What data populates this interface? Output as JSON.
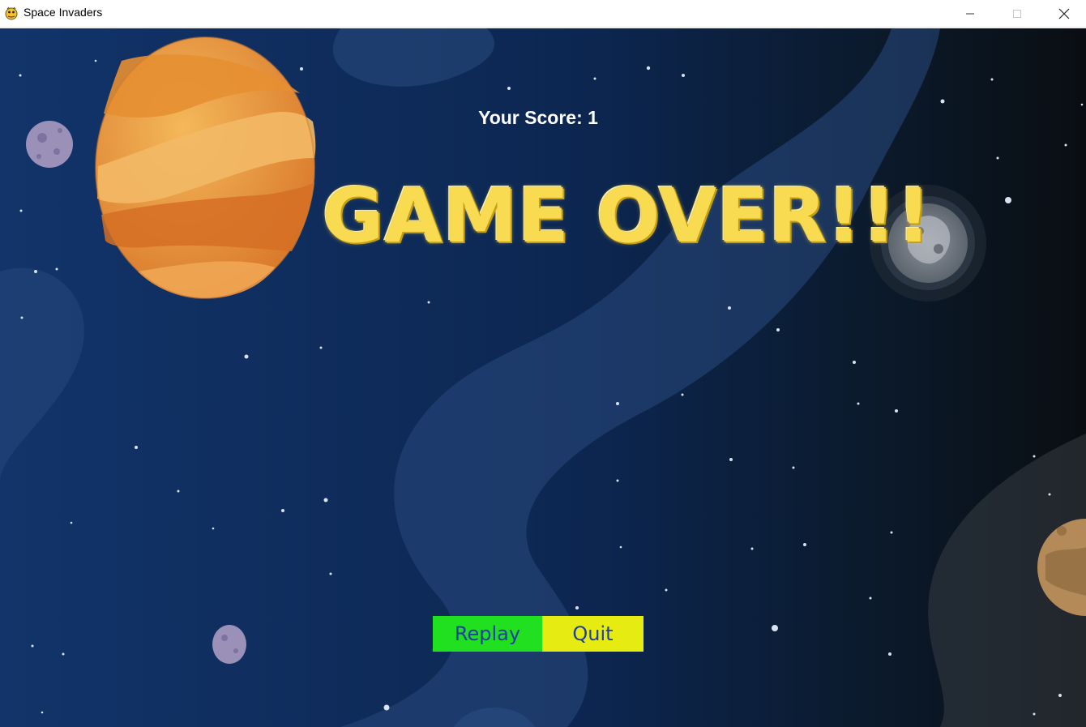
{
  "window": {
    "title": "Space Invaders",
    "icon": "pygame-snake-icon",
    "controls": {
      "minimize": "minimize-icon",
      "maximize": "maximize-icon",
      "close": "close-icon"
    }
  },
  "game": {
    "score_text": "Your Score: 1",
    "headline": "GAME OVER!!!",
    "buttons": {
      "replay": "Replay",
      "quit": "Quit"
    },
    "colors": {
      "replay_bg": "#20e020",
      "quit_bg": "#e6ec12",
      "button_text": "#1e3fa0",
      "headline": "#f9db52"
    }
  }
}
